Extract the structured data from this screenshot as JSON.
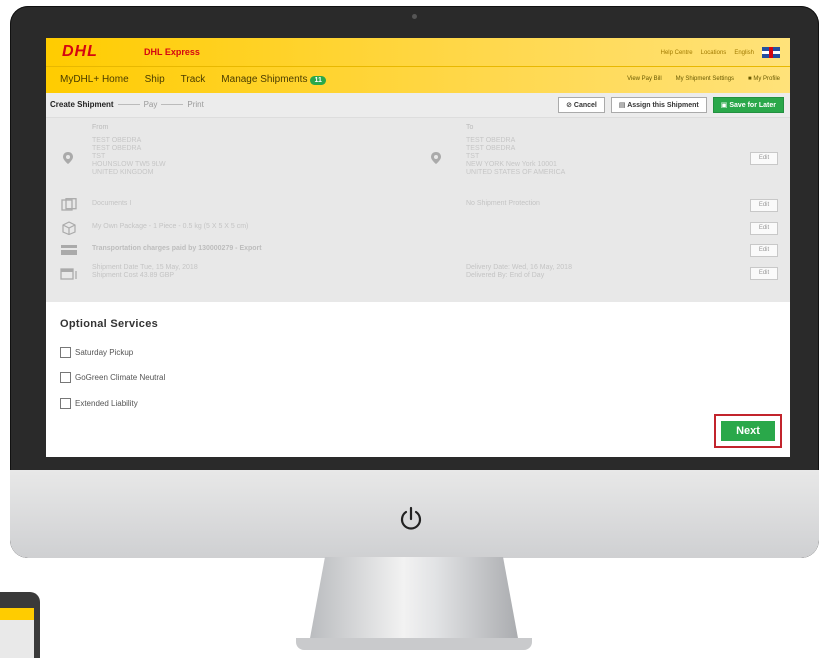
{
  "header": {
    "logo_text": "DHL",
    "brand": "DHL Express",
    "links": [
      "Help Centre",
      "Locations",
      "English"
    ]
  },
  "nav": {
    "items": [
      "MyDHL+ Home",
      "Ship",
      "Track",
      "Manage Shipments"
    ],
    "shipments_badge": "11",
    "right_links": [
      "View Pay Bill",
      "My Shipment Settings",
      "My Profile"
    ]
  },
  "steps": {
    "current": "Create Shipment",
    "next": [
      "Pay",
      "Print"
    ]
  },
  "actions": {
    "cancel": "Cancel",
    "assign": "Assign this Shipment",
    "save": "Save for Later"
  },
  "from": {
    "label": "From",
    "lines": [
      "TEST OBEDRA",
      "TEST OBEDRA",
      "TST",
      "HOUNSLOW TW5 9LW",
      "UNITED KINGDOM"
    ]
  },
  "to": {
    "label": "To",
    "lines": [
      "TEST OBEDRA",
      "TEST OBEDRA",
      "TST",
      "NEW YORK New York 10001",
      "UNITED STATES OF AMERICA"
    ]
  },
  "rows": {
    "documents": "Documents I",
    "protection": "No Shipment Protection",
    "package": "My Own Package - 1 Piece - 0.5 kg (5 X 5 X 5 cm)",
    "transport": "Transportation charges paid by 130000279 - Export",
    "shipment_date": "Shipment Date Tue, 15 May, 2018",
    "shipment_cost": "Shipment Cost 43.89 GBP",
    "delivery_date": "Delivery Date: Wed, 16 May, 2018",
    "delivered_by": "Delivered By: End of Day",
    "edit_label": "Edit"
  },
  "optional": {
    "title": "Optional Services",
    "items": [
      "Saturday Pickup",
      "GoGreen Climate Neutral",
      "Extended Liability"
    ]
  },
  "next_label": "Next",
  "colors": {
    "dhl_yellow": "#ffcc00",
    "dhl_red": "#d40511",
    "green": "#2aa84a",
    "highlight": "#c2242c"
  }
}
